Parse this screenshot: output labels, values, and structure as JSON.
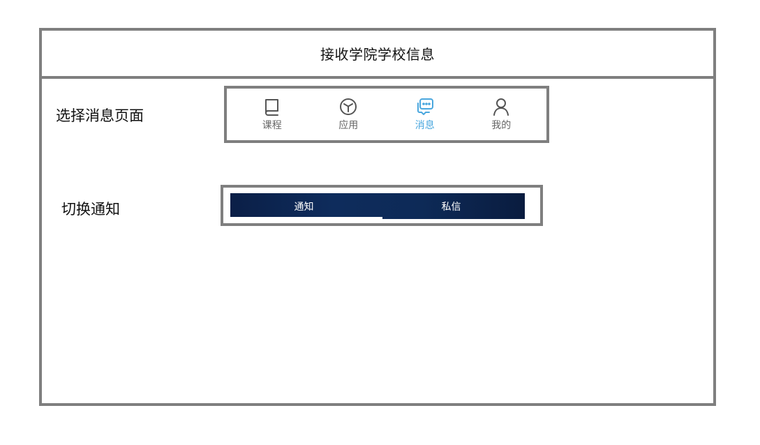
{
  "header": {
    "title": "接收学院学校信息"
  },
  "labels": {
    "select_page": "选择消息页面",
    "switch_notice": "切换通知"
  },
  "nav": {
    "items": [
      {
        "label": "课程",
        "icon": "book-icon",
        "active": false
      },
      {
        "label": "应用",
        "icon": "cube-icon",
        "active": false
      },
      {
        "label": "消息",
        "icon": "chat-icon",
        "active": true
      },
      {
        "label": "我的",
        "icon": "user-icon",
        "active": false
      }
    ],
    "active_color": "#4aa7de",
    "inactive_color": "#666666"
  },
  "tabs": {
    "items": [
      {
        "label": "通知",
        "selected": true
      },
      {
        "label": "私信",
        "selected": false
      }
    ],
    "bar_color": "#0d2a57"
  },
  "colors": {
    "border": "#7f7f7f"
  }
}
